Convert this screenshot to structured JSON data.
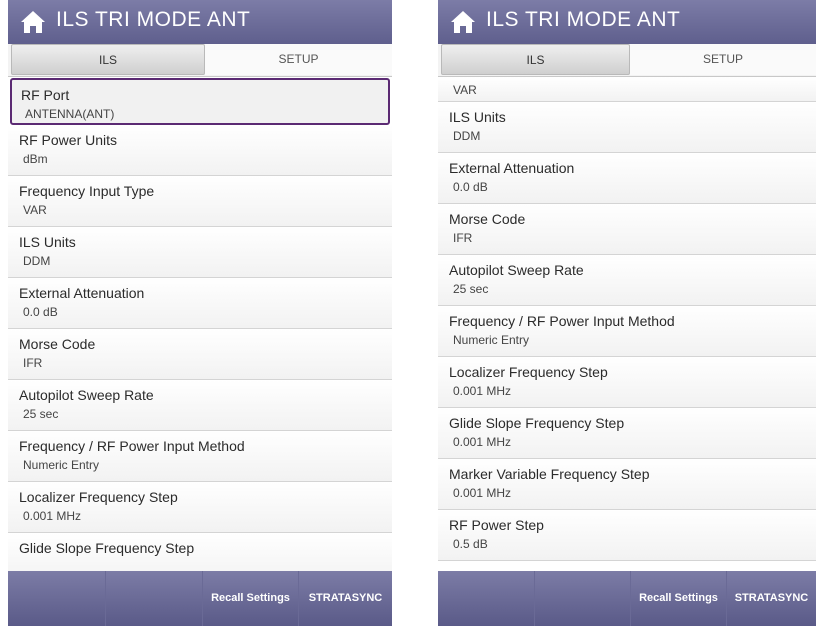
{
  "left": {
    "title": "ILS TRI MODE  ANT",
    "tabs": [
      "ILS",
      "SETUP"
    ],
    "rows": [
      {
        "label": "RF Port",
        "value": "ANTENNA(ANT)"
      },
      {
        "label": "RF Power Units",
        "value": "dBm"
      },
      {
        "label": "Frequency Input Type",
        "value": "VAR"
      },
      {
        "label": "ILS Units",
        "value": "DDM"
      },
      {
        "label": "External Attenuation",
        "value": "0.0 dB"
      },
      {
        "label": "Morse Code",
        "value": "IFR"
      },
      {
        "label": "Autopilot Sweep Rate",
        "value": "25 sec"
      },
      {
        "label": "Frequency / RF Power Input Method",
        "value": "Numeric Entry"
      },
      {
        "label": "Localizer Frequency Step",
        "value": "0.001 MHz"
      },
      {
        "label": "Glide Slope Frequency Step",
        "value": ""
      }
    ],
    "footer": [
      "",
      "",
      "Recall Settings",
      "STRATASYNC"
    ]
  },
  "right": {
    "title": "ILS TRI MODE  ANT",
    "tabs": [
      "ILS",
      "SETUP"
    ],
    "top_value": "VAR",
    "rows": [
      {
        "label": "ILS Units",
        "value": "DDM"
      },
      {
        "label": "External Attenuation",
        "value": "0.0 dB"
      },
      {
        "label": "Morse Code",
        "value": "IFR"
      },
      {
        "label": "Autopilot Sweep Rate",
        "value": "25 sec"
      },
      {
        "label": "Frequency / RF Power Input Method",
        "value": "Numeric Entry"
      },
      {
        "label": "Localizer Frequency Step",
        "value": "0.001 MHz"
      },
      {
        "label": "Glide Slope Frequency Step",
        "value": "0.001 MHz"
      },
      {
        "label": "Marker Variable Frequency Step",
        "value": "0.001 MHz"
      },
      {
        "label": "RF Power Step",
        "value": "0.5 dB"
      }
    ],
    "footer": [
      "",
      "",
      "Recall Settings",
      "STRATASYNC"
    ]
  },
  "colors": {
    "titlebar": "#6d6d9a",
    "selected_border": "#5b2a73",
    "footer": "#6b6b97"
  }
}
